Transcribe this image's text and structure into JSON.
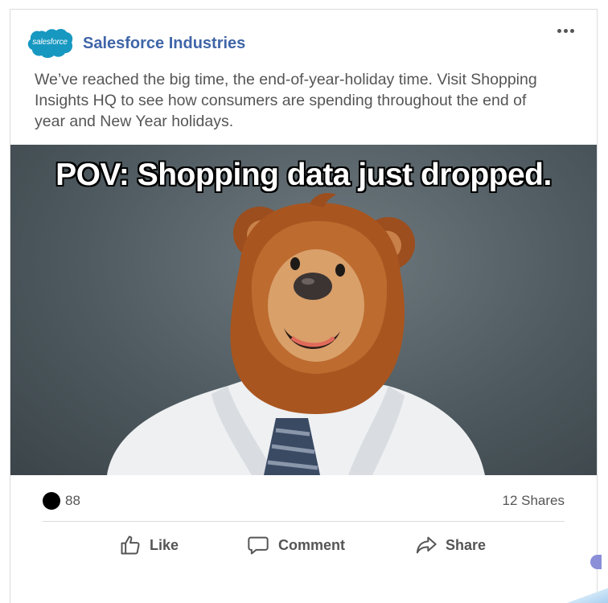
{
  "header": {
    "logo_text": "salesforce",
    "org_name": "Salesforce Industries",
    "more_icon": "more-horizontal-icon"
  },
  "post": {
    "text": "We’ve reached the big time, the end-of-year-holiday time. Visit Shopping Insights HQ to see how consumers are spending throughout the end of year and New Year holidays."
  },
  "media": {
    "caption": "POV: Shopping data just dropped."
  },
  "stats": {
    "reaction_count": "88",
    "shares": "12 Shares"
  },
  "actions": {
    "like": "Like",
    "comment": "Comment",
    "share": "Share"
  },
  "colors": {
    "brand_blue": "#3f65a8",
    "logo_cloud": "#1798c1",
    "text_gray": "#555555"
  }
}
